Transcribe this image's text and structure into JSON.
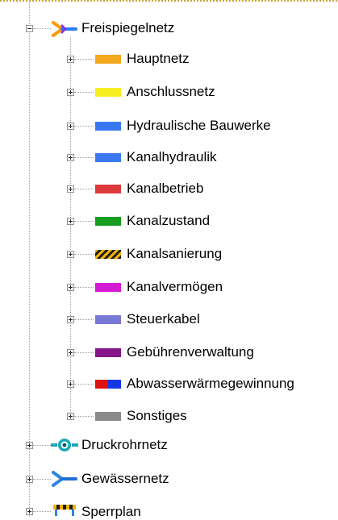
{
  "tree": {
    "root": {
      "label": "Freispiegelnetz",
      "icon": "y-connector-icon",
      "expanded": true
    },
    "children": [
      {
        "label": "Hauptnetz",
        "swatch": "#f4a81e"
      },
      {
        "label": "Anschlussnetz",
        "swatch": "#f7ee22"
      },
      {
        "label": "Hydraulische Bauwerke",
        "swatch": "#3a78f2"
      },
      {
        "label": "Kanalhydraulik",
        "swatch": "#3a78f2"
      },
      {
        "label": "Kanalbetrieb",
        "swatch": "#dc3a3a"
      },
      {
        "label": "Kanalzustand",
        "swatch": "#169c1e"
      },
      {
        "label": "Kanalsanierung",
        "swatch": "hatched-yellow-black"
      },
      {
        "label": "Kanalvermögen",
        "swatch": "#d21ad2"
      },
      {
        "label": "Steuerkabel",
        "swatch": "#7878d6"
      },
      {
        "label": "Gebührenverwaltung",
        "swatch": "#86178a"
      },
      {
        "label": "Abwasserwärmegewinnung",
        "swatch": "red-blue-split"
      },
      {
        "label": "Sonstiges",
        "swatch": "#8a8a8a"
      }
    ],
    "siblings": [
      {
        "label": "Druckrohrnetz",
        "icon": "pressure-pipe-icon"
      },
      {
        "label": "Gewässernetz",
        "icon": "river-connector-icon"
      },
      {
        "label": "Sperrplan",
        "icon": "barrier-icon"
      }
    ]
  }
}
